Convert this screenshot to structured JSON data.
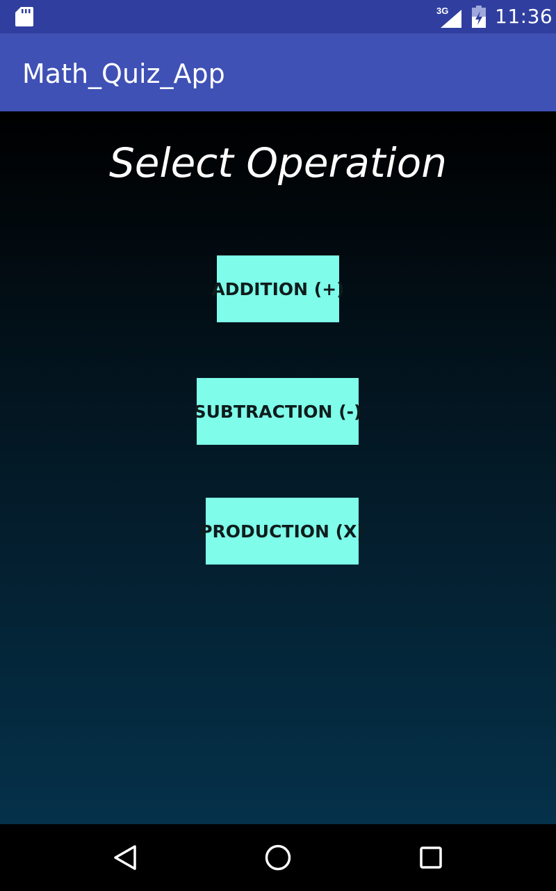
{
  "status_bar": {
    "network": "3G",
    "time": "11:36",
    "icons": [
      "sd-card-icon",
      "signal-icon",
      "battery-icon"
    ]
  },
  "app_bar": {
    "title": "Math_Quiz_App",
    "color": "#3F51B5"
  },
  "main": {
    "heading": "Select Operation",
    "buttons": [
      {
        "label": "ADDITION (+)"
      },
      {
        "label": "SUBTRACTION (-)"
      },
      {
        "label": "PRODUCTION (X)"
      }
    ],
    "button_color": "#7FFDEA"
  },
  "nav_bar": {
    "icons": [
      "back-icon",
      "home-icon",
      "recent-apps-icon"
    ]
  }
}
